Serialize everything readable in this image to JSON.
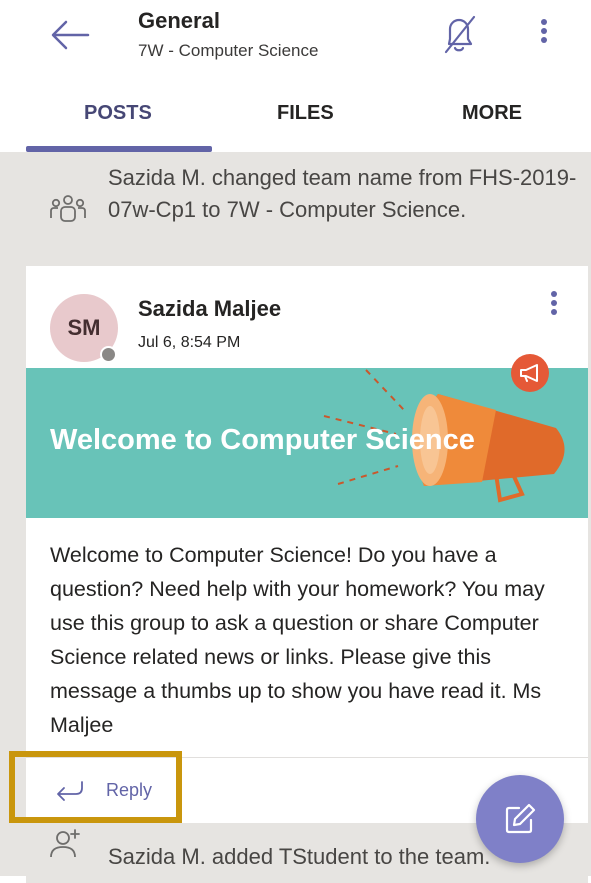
{
  "header": {
    "title": "General",
    "subtitle": "7W - Computer Science"
  },
  "tabs": [
    {
      "label": "POSTS",
      "selected": true
    },
    {
      "label": "FILES",
      "selected": false
    },
    {
      "label": "MORE",
      "selected": false
    }
  ],
  "feed": {
    "system_messages": [
      {
        "text": "Sazida M. changed team name from FHS-2019-07w-Cp1 to 7W - Computer Science.",
        "icon": "team-icon"
      },
      {
        "text": "Sazida M. added TStudent to the team.",
        "icon": "add-person-icon"
      }
    ],
    "post": {
      "avatar_initials": "SM",
      "author": "Sazida Maljee",
      "timestamp": "Jul 6, 8:54 PM",
      "banner_title": "Welcome to Computer Science",
      "body": "Welcome to Computer Science! Do you have a question? Need help with your homework? You may use this group to ask a question or share Computer Science related news or links. Please give this message a thumbs up to show you have read it. Ms Maljee",
      "reply_label": "Reply"
    }
  },
  "colors": {
    "accent": "#6264a7",
    "banner": "#68c3b8",
    "announcement": "#e55937",
    "fab": "#7f80c8",
    "highlight": "#c9960d"
  },
  "icons": {
    "back": "arrow-left-icon",
    "notifications": "bell-off-icon",
    "more": "more-vertical-icon",
    "compose": "compose-icon",
    "announcement": "megaphone-icon",
    "reply": "reply-arrow-icon"
  }
}
